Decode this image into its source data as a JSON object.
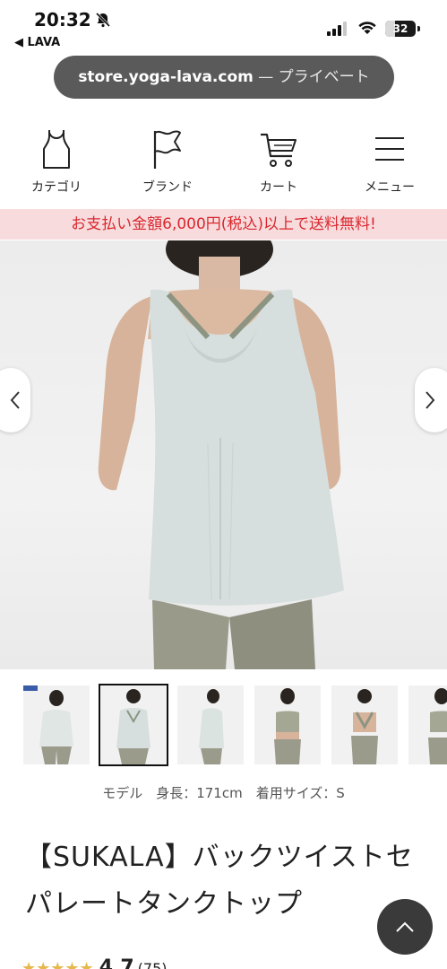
{
  "status": {
    "time": "20:32",
    "back_app": "◀ LAVA",
    "battery": "32",
    "battery_level": 0.32
  },
  "urlbar": {
    "domain": "store.yoga-lava.com",
    "privacy": " — プライベート"
  },
  "nav": {
    "items": [
      {
        "label": "カテゴリ",
        "icon": "tank-top-icon"
      },
      {
        "label": "ブランド",
        "icon": "flag-icon"
      },
      {
        "label": "カート",
        "icon": "cart-icon"
      },
      {
        "label": "メニュー",
        "icon": "menu-icon"
      }
    ]
  },
  "banner": {
    "text": "お支払い金額6,000円(税込)以上で送料無料!"
  },
  "gallery": {
    "selected_index": 1,
    "thumb_count": 6
  },
  "product": {
    "model_info": "モデル　身長：171cm　着用サイズ：S",
    "title": "【SUKALA】バックツイストセパレートタンクトップ",
    "rating_value": "4.7",
    "rating_count": "(75)"
  },
  "colors": {
    "banner_bg": "#f8dcdd",
    "banner_text": "#d9282f",
    "star": "#e4b84b"
  }
}
